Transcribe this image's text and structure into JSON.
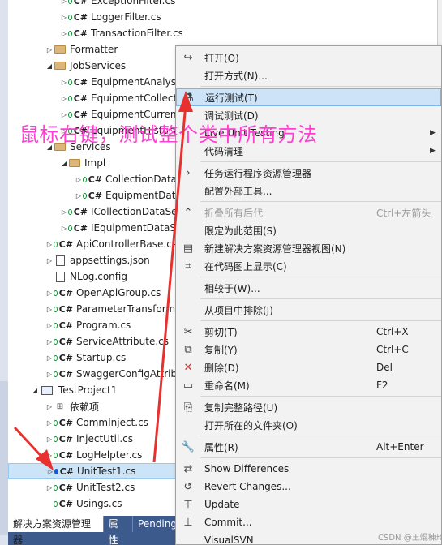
{
  "tree": {
    "items": [
      {
        "label": "ExceptionFilter.cs",
        "kind": "cs",
        "exp": "▷",
        "indent": 64
      },
      {
        "label": "LoggerFilter.cs",
        "kind": "cs",
        "exp": "▷",
        "indent": 64
      },
      {
        "label": "TransactionFilter.cs",
        "kind": "cs",
        "exp": "▷",
        "indent": 64
      },
      {
        "label": "Formatter",
        "kind": "folder",
        "exp": "▷",
        "indent": 46
      },
      {
        "label": "JobServices",
        "kind": "folder",
        "exp": "◢",
        "indent": 46
      },
      {
        "label": "EquipmentAnalysisJob.cs",
        "kind": "cs",
        "exp": "▷",
        "indent": 64
      },
      {
        "label": "EquipmentCollectionJob.cs",
        "kind": "cs",
        "exp": "▷",
        "indent": 64
      },
      {
        "label": "EquipmentCurrentJob.cs",
        "kind": "cs",
        "exp": "▷",
        "indent": 64
      },
      {
        "label": "EquipmentHistoryJob.cs",
        "kind": "cs",
        "exp": "▷",
        "indent": 64
      },
      {
        "label": "Services",
        "kind": "folder",
        "exp": "◢",
        "indent": 46
      },
      {
        "label": "Impl",
        "kind": "folder",
        "exp": "◢",
        "indent": 64
      },
      {
        "label": "CollectionDataService.cs",
        "kind": "cs",
        "exp": "▷",
        "indent": 82
      },
      {
        "label": "EquipmentDataService.cs",
        "kind": "cs",
        "exp": "▷",
        "indent": 82
      },
      {
        "label": "ICollectionDataService.cs",
        "kind": "cs",
        "exp": "▷",
        "indent": 64
      },
      {
        "label": "IEquipmentDataService.cs",
        "kind": "cs",
        "exp": "▷",
        "indent": 64
      },
      {
        "label": "ApiControllerBase.cs",
        "kind": "cs",
        "exp": "▷",
        "indent": 46
      },
      {
        "label": "appsettings.json",
        "kind": "file",
        "exp": "▷",
        "indent": 46
      },
      {
        "label": "NLog.config",
        "kind": "file",
        "exp": "",
        "indent": 46
      },
      {
        "label": "OpenApiGroup.cs",
        "kind": "cs",
        "exp": "▷",
        "indent": 46
      },
      {
        "label": "ParameterTransformer.cs",
        "kind": "cs",
        "exp": "▷",
        "indent": 46
      },
      {
        "label": "Program.cs",
        "kind": "cs",
        "exp": "▷",
        "indent": 46
      },
      {
        "label": "ServiceAttribute.cs",
        "kind": "cs",
        "exp": "▷",
        "indent": 46
      },
      {
        "label": "Startup.cs",
        "kind": "cs",
        "exp": "▷",
        "indent": 46
      },
      {
        "label": "SwaggerConfigAttribute.cs",
        "kind": "cs",
        "exp": "▷",
        "indent": 46
      },
      {
        "label": "TestProject1",
        "kind": "proj",
        "exp": "◢",
        "indent": 28
      },
      {
        "label": "依赖项",
        "kind": "dep",
        "exp": "▷",
        "indent": 46
      },
      {
        "label": "CommInject.cs",
        "kind": "cs",
        "exp": "▷",
        "indent": 46
      },
      {
        "label": "InjectUtil.cs",
        "kind": "cs",
        "exp": "▷",
        "indent": 46
      },
      {
        "label": "LogHelpter.cs",
        "kind": "cs",
        "exp": "▷",
        "indent": 46
      },
      {
        "label": "UnitTest1.cs",
        "kind": "cs-selected",
        "exp": "▷",
        "indent": 46
      },
      {
        "label": "UnitTest2.cs",
        "kind": "cs",
        "exp": "▷",
        "indent": 46
      },
      {
        "label": "Usings.cs",
        "kind": "cs",
        "exp": "",
        "indent": 46
      }
    ],
    "cs_tag": "C#",
    "dep_glyph": "⊞"
  },
  "bottom_tabs": [
    {
      "label": "解决方案资源管理器",
      "active": true
    },
    {
      "label": "属性",
      "active": false
    },
    {
      "label": "Pending",
      "active": false
    }
  ],
  "context_menu": {
    "items": [
      {
        "type": "item",
        "label": "打开(O)",
        "icon": "↪",
        "icon_name": "open-icon"
      },
      {
        "type": "item",
        "label": "打开方式(N)...",
        "icon": "",
        "icon_name": "open-with-icon"
      },
      {
        "type": "sep"
      },
      {
        "type": "item",
        "label": "运行测试(T)",
        "icon": "⚗",
        "icon_name": "run-tests-icon",
        "highlight": true
      },
      {
        "type": "item",
        "label": "调试测试(D)",
        "icon": "",
        "icon_name": "debug-tests-icon"
      },
      {
        "type": "item",
        "label": "Live Unit Testing",
        "icon": "",
        "icon_name": "live-unit-testing-icon",
        "submenu": true
      },
      {
        "type": "item",
        "label": "代码清理",
        "icon": "",
        "icon_name": "code-cleanup-icon",
        "submenu": true
      },
      {
        "type": "sep"
      },
      {
        "type": "item",
        "label": "任务运行程序资源管理器",
        "icon": "›",
        "icon_name": "task-runner-icon"
      },
      {
        "type": "item",
        "label": "配置外部工具...",
        "icon": "",
        "icon_name": "external-tools-icon"
      },
      {
        "type": "sep"
      },
      {
        "type": "item",
        "label": "折叠所有后代",
        "shortcut": "Ctrl+左箭头",
        "icon": "⌃",
        "icon_name": "collapse-all-icon",
        "disabled": true
      },
      {
        "type": "item",
        "label": "限定为此范围(S)",
        "icon": "",
        "icon_name": "scope-icon"
      },
      {
        "type": "item",
        "label": "新建解决方案资源管理器视图(N)",
        "icon": "▤",
        "icon_name": "new-view-icon"
      },
      {
        "type": "item",
        "label": "在代码图上显示(C)",
        "icon": "⌗",
        "icon_name": "code-map-icon"
      },
      {
        "type": "sep"
      },
      {
        "type": "item",
        "label": "相较于(W)...",
        "icon": "",
        "icon_name": "compare-icon"
      },
      {
        "type": "sep"
      },
      {
        "type": "item",
        "label": "从项目中排除(J)",
        "icon": "",
        "icon_name": "exclude-icon"
      },
      {
        "type": "sep"
      },
      {
        "type": "item",
        "label": "剪切(T)",
        "shortcut": "Ctrl+X",
        "icon": "✂",
        "icon_name": "cut-icon"
      },
      {
        "type": "item",
        "label": "复制(Y)",
        "shortcut": "Ctrl+C",
        "icon": "⧉",
        "icon_name": "copy-icon"
      },
      {
        "type": "item",
        "label": "删除(D)",
        "shortcut": "Del",
        "icon": "✕",
        "icon_name": "delete-icon",
        "icon_color": "#d32f2f"
      },
      {
        "type": "item",
        "label": "重命名(M)",
        "shortcut": "F2",
        "icon": "▭",
        "icon_name": "rename-icon"
      },
      {
        "type": "sep"
      },
      {
        "type": "item",
        "label": "复制完整路径(U)",
        "icon": "⎘",
        "icon_name": "copy-path-icon"
      },
      {
        "type": "item",
        "label": "打开所在的文件夹(O)",
        "icon": "",
        "icon_name": "open-folder-icon"
      },
      {
        "type": "sep"
      },
      {
        "type": "item",
        "label": "属性(R)",
        "shortcut": "Alt+Enter",
        "icon": "🔧",
        "icon_name": "properties-icon"
      },
      {
        "type": "sep"
      },
      {
        "type": "item",
        "label": "Show Differences",
        "icon": "⇄",
        "icon_name": "show-differences-icon"
      },
      {
        "type": "item",
        "label": "Revert Changes...",
        "icon": "↺",
        "icon_name": "revert-icon"
      },
      {
        "type": "item",
        "label": "Update",
        "icon": "⊤",
        "icon_name": "update-icon"
      },
      {
        "type": "item",
        "label": "Commit...",
        "icon": "⊥",
        "icon_name": "commit-icon"
      },
      {
        "type": "item",
        "label": "VisualSVN",
        "icon": "",
        "icon_name": "visualsvn-icon"
      }
    ],
    "submenu_glyph": "▶"
  },
  "annotation": {
    "text": "鼠标右键，测试整个类中所有方法",
    "color": "#ff3fcf"
  },
  "arrow_color": "#e8312f",
  "watermark": "CSDN @王焜棟琦",
  "colors": {
    "selection": "#cce4f7",
    "menu_highlight": "#cde3f8",
    "tab_bar": "#3d5a8c"
  }
}
